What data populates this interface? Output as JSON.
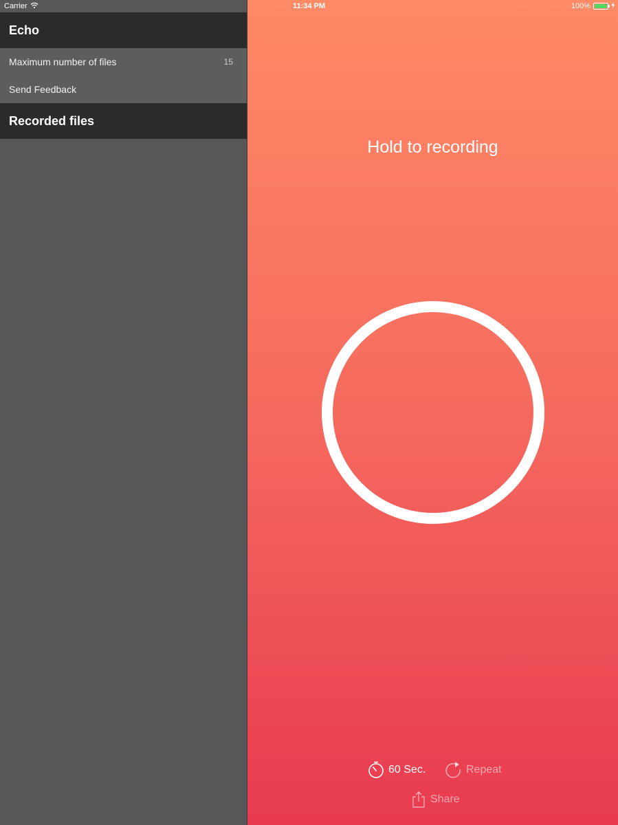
{
  "status_bar": {
    "carrier": "Carrier",
    "time": "11:34 PM",
    "battery": "100%"
  },
  "sidebar": {
    "app_title": "Echo",
    "items": [
      {
        "label": "Maximum number of files",
        "value": "15"
      },
      {
        "label": "Send Feedback",
        "value": ""
      }
    ],
    "recorded_header": "Recorded files"
  },
  "main": {
    "title": "Hold to recording",
    "timer_label": "60 Sec.",
    "repeat_label": "Repeat",
    "share_label": "Share"
  },
  "colors": {
    "gradient_top": "#ff8a66",
    "gradient_bottom": "#e83a50",
    "sidebar_bg": "#575757",
    "header_bg": "#2b2b2b",
    "battery_fill": "#4cd964"
  },
  "icons": {
    "wifi": "wifi-icon",
    "battery": "battery-icon",
    "timer": "timer-icon",
    "repeat": "repeat-icon",
    "share": "share-icon"
  }
}
